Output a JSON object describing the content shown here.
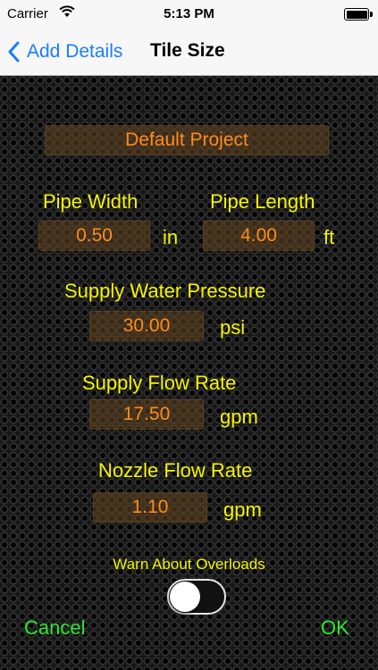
{
  "status_bar": {
    "carrier": "Carrier",
    "time": "5:13 PM"
  },
  "nav": {
    "back_label": "Add Details",
    "title": "Tile Size"
  },
  "project": {
    "name": "Default Project"
  },
  "pipe": {
    "width_label": "Pipe Width",
    "width_value": "0.50",
    "width_unit": "in",
    "length_label": "Pipe Length",
    "length_value": "4.00",
    "length_unit": "ft"
  },
  "pressure": {
    "label": "Supply Water Pressure",
    "value": "30.00",
    "unit": "psi"
  },
  "supply_flow": {
    "label": "Supply Flow Rate",
    "value": "17.50",
    "unit": "gpm"
  },
  "nozzle_flow": {
    "label": "Nozzle Flow Rate",
    "value": "1.10",
    "unit": "gpm"
  },
  "overload": {
    "label": "Warn About Overloads",
    "enabled": false
  },
  "actions": {
    "cancel": "Cancel",
    "ok": "OK"
  },
  "colors": {
    "label": "#f5f500",
    "value": "#ff8c1a",
    "action": "#2ee82e",
    "link": "#1a7efb"
  }
}
